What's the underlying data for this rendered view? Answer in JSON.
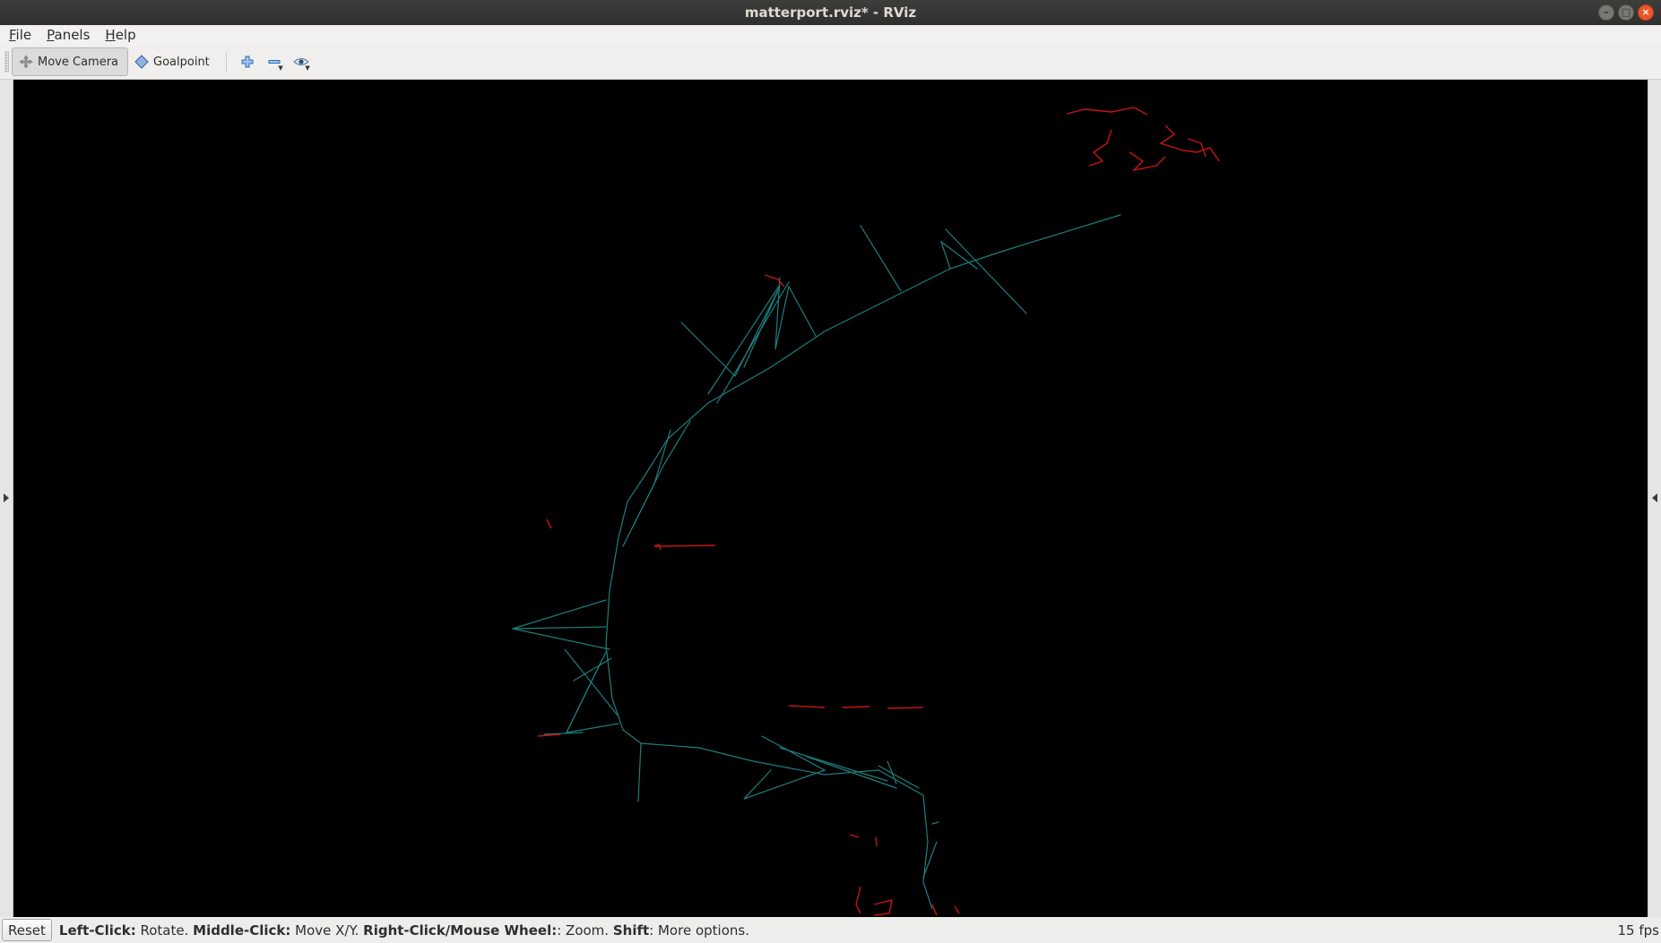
{
  "window": {
    "title": "matterport.rviz* - RViz"
  },
  "menubar": {
    "items": [
      {
        "label": "File",
        "mnemonic": "F",
        "rest": "ile"
      },
      {
        "label": "Panels",
        "mnemonic": "P",
        "rest": "anels"
      },
      {
        "label": "Help",
        "mnemonic": "H",
        "rest": "elp"
      }
    ]
  },
  "toolbar": {
    "move_camera": "Move Camera",
    "goalpoint": "Goalpoint",
    "icons": [
      "plus-icon",
      "minus-icon",
      "eye-icon"
    ]
  },
  "status": {
    "reset": "Reset",
    "hints": [
      {
        "key": "Left-Click:",
        "action": " Rotate. "
      },
      {
        "key": "Middle-Click:",
        "action": " Move X/Y. "
      },
      {
        "key": "Right-Click/Mouse Wheel:",
        "action": ": Zoom. "
      },
      {
        "key": "Shift",
        "action": ": More options."
      }
    ],
    "fps": "15 fps"
  },
  "colors": {
    "trajectory": "#1d7e7e",
    "pointcloud": "#c81414",
    "viewport_bg": "#000000"
  }
}
